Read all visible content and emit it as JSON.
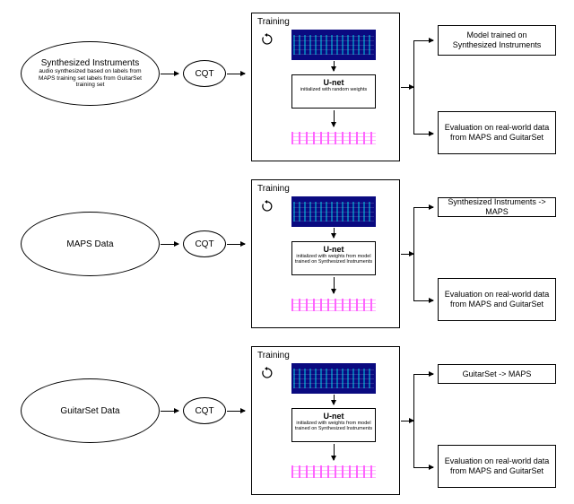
{
  "rows": [
    {
      "source": {
        "title": "Synthesized Instruments",
        "sub": "audio synthesized based on labels from MAPS training set labels from GuitarSet training set"
      },
      "cqt": "CQT",
      "training": {
        "label": "Training",
        "unet_title": "U-net",
        "unet_sub": "initialized with random weights"
      },
      "out1": "Model trained on Synthesized Instruments",
      "out2": "Evaluation on real-world data from MAPS and GuitarSet"
    },
    {
      "source": {
        "title": "MAPS Data",
        "sub": ""
      },
      "cqt": "CQT",
      "training": {
        "label": "Training",
        "unet_title": "U-net",
        "unet_sub": "initialized with weights from model trained on Synthesized Instruments"
      },
      "out1": "Synthesized Instruments -> MAPS",
      "out2": "Evaluation on real-world data from MAPS and GuitarSet"
    },
    {
      "source": {
        "title": "GuitarSet Data",
        "sub": ""
      },
      "cqt": "CQT",
      "training": {
        "label": "Training",
        "unet_title": "U-net",
        "unet_sub": "initialized with weights from model trained on Synthesized Instruments"
      },
      "out1": "GuitarSet -> MAPS",
      "out2": "Evaluation on real-world data from MAPS and GuitarSet"
    }
  ]
}
